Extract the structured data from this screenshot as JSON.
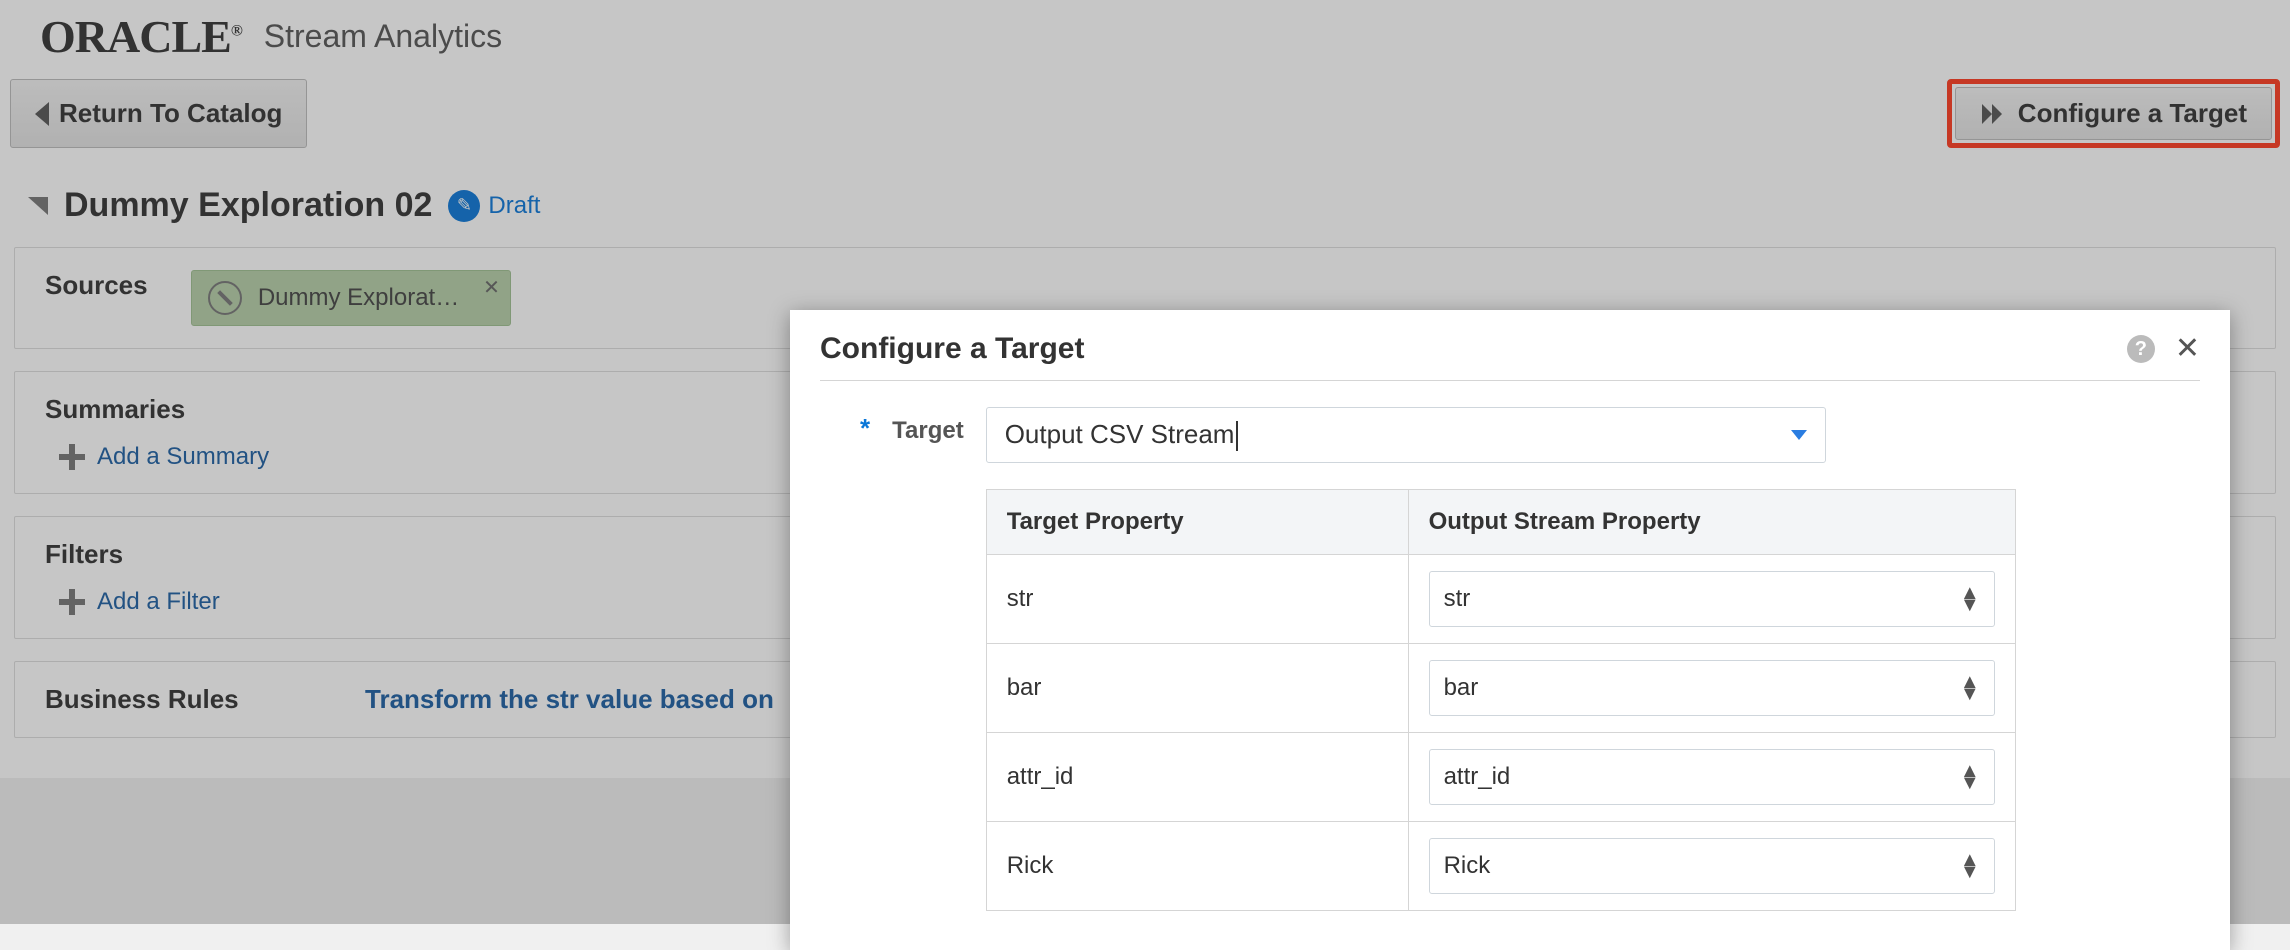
{
  "header": {
    "logo_text": "ORACLE",
    "app_title": "Stream Analytics"
  },
  "toolbar": {
    "return_label": "Return To Catalog",
    "configure_label": "Configure a Target"
  },
  "exploration": {
    "title": "Dummy Exploration 02",
    "status": "Draft"
  },
  "sources": {
    "label": "Sources",
    "chip_text": "Dummy Explorat…"
  },
  "summaries": {
    "label": "Summaries",
    "add_label": "Add a Summary"
  },
  "filters": {
    "label": "Filters",
    "add_label": "Add a Filter"
  },
  "business_rules": {
    "label": "Business Rules",
    "transform_text": "Transform the str value based on"
  },
  "modal": {
    "title": "Configure a Target",
    "target_label": "Target",
    "target_value": "Output CSV Stream",
    "col1": "Target Property",
    "col2": "Output Stream Property",
    "rows": [
      {
        "prop": "str",
        "out": "str"
      },
      {
        "prop": "bar",
        "out": "bar"
      },
      {
        "prop": "attr_id",
        "out": "attr_id"
      },
      {
        "prop": "Rick",
        "out": "Rick"
      }
    ]
  }
}
